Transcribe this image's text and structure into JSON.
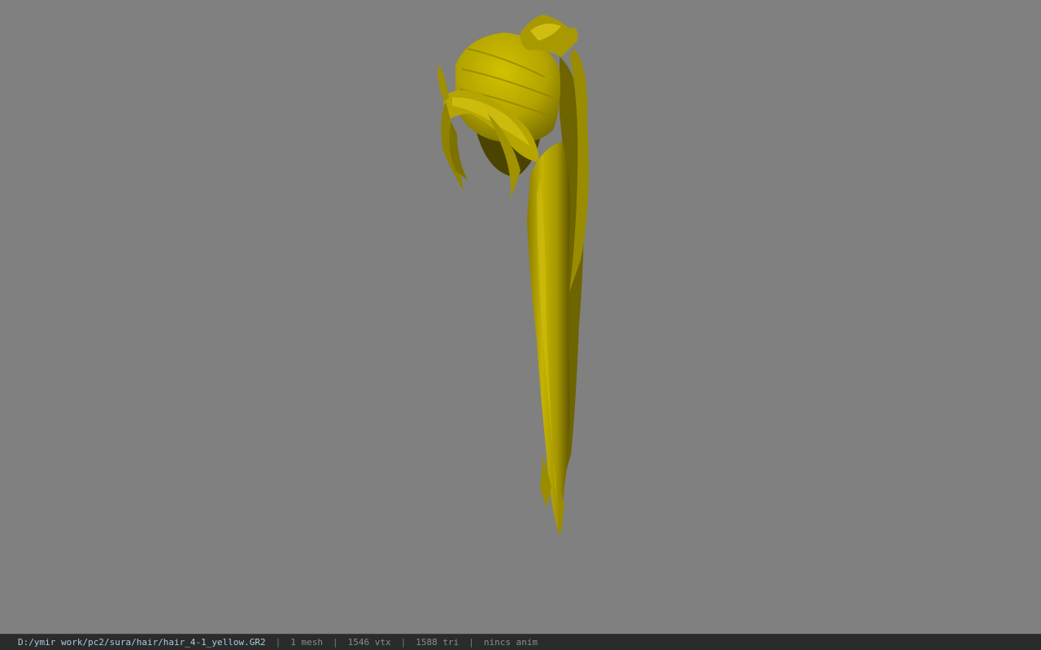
{
  "viewport": {
    "background_color": "#808080",
    "model_color": "#b8a800",
    "model_shadow_color": "#4a4400",
    "model_description": "yellow ponytail hair mesh"
  },
  "status_bar": {
    "file_path": "D:/ymir work/pc2/sura/hair/hair_4-1_yellow.GR2",
    "separator": "|",
    "mesh_count": "1 mesh",
    "vertex_count": "1546 vtx",
    "triangle_count": "1588 tri",
    "animation": "nincs anim",
    "path_color": "#a9cbe0",
    "text_color": "#8c8c8c",
    "background_color": "#2b2b2b"
  }
}
